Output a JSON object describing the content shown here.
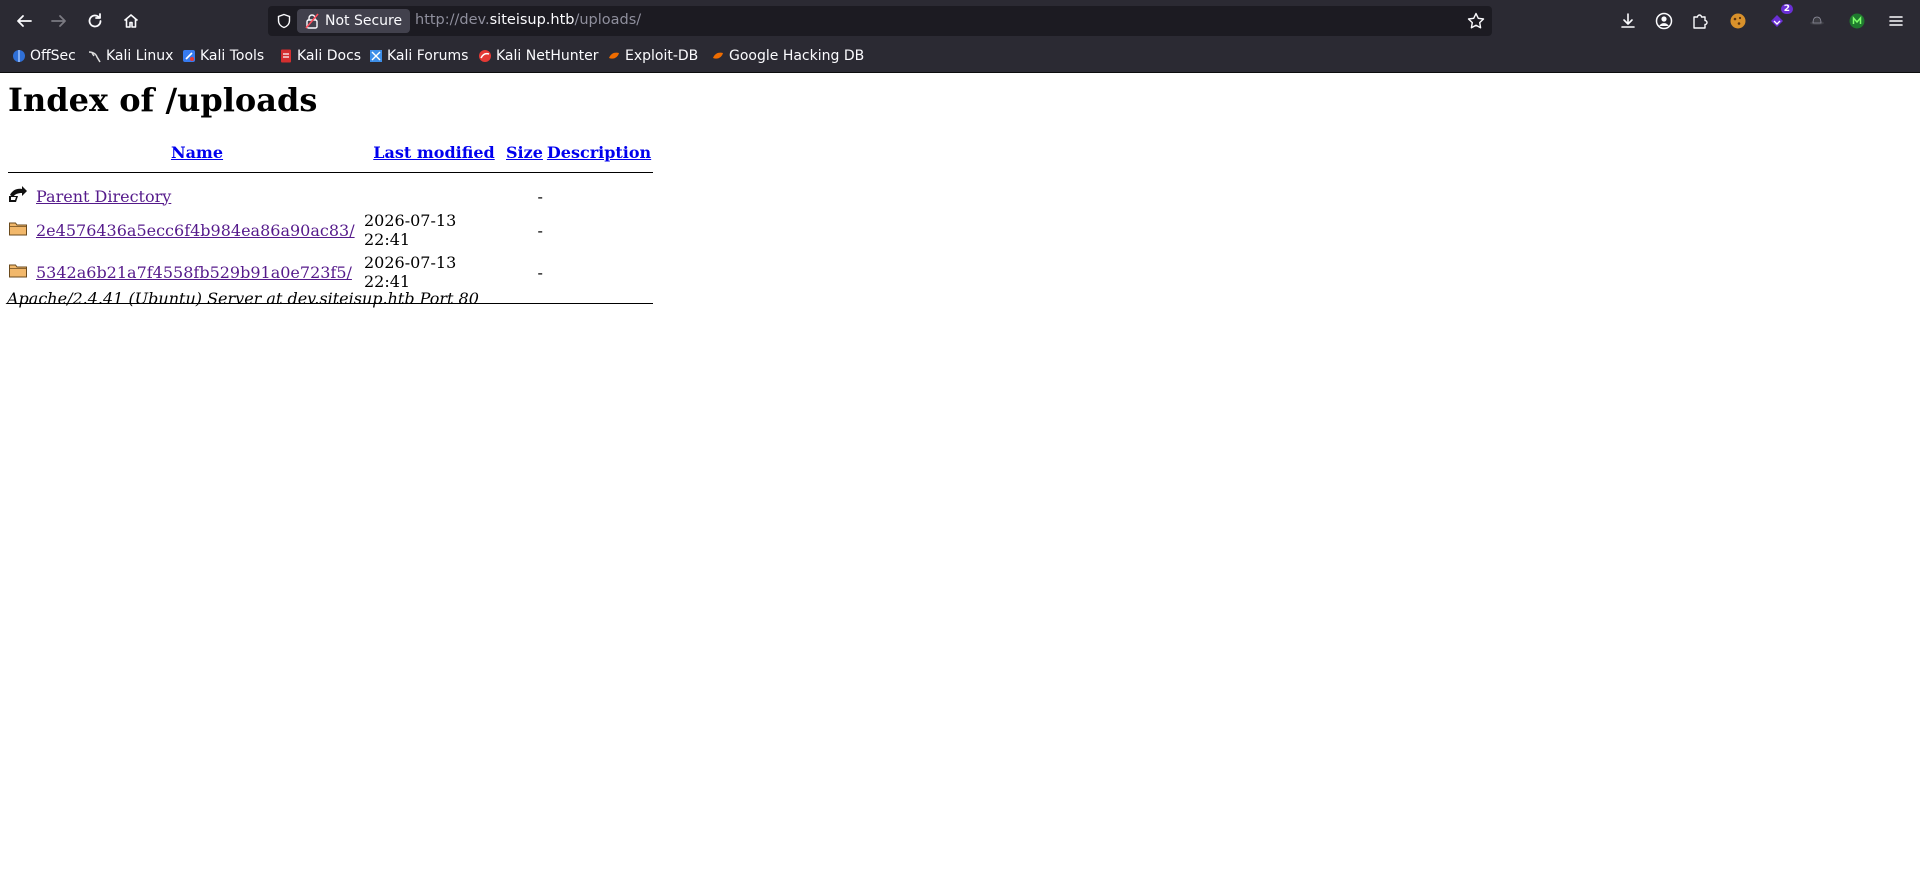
{
  "browser": {
    "security_label": "Not Secure",
    "url_prefix": "http://dev.",
    "url_host": "siteisup.htb",
    "url_path": "/uploads/",
    "extension_badge_count": "2"
  },
  "bookmarks": [
    {
      "label": "OffSec",
      "icon": "offsec-icon",
      "color": "#2f6fd6"
    },
    {
      "label": "Kali Linux",
      "icon": "kali-dragon-icon",
      "color": "#dddddd"
    },
    {
      "label": "Kali Tools",
      "icon": "kali-tools-icon",
      "color": "#367bf0"
    },
    {
      "label": "Kali Docs",
      "icon": "kali-docs-icon",
      "color": "#d32f2f"
    },
    {
      "label": "Kali Forums",
      "icon": "kali-forums-icon",
      "color": "#3d8ee8"
    },
    {
      "label": "Kali NetHunter",
      "icon": "nethunter-icon",
      "color": "#e53935"
    },
    {
      "label": "Exploit-DB",
      "icon": "exploitdb-icon",
      "color": "#ef6c00"
    },
    {
      "label": "Google Hacking DB",
      "icon": "ghdb-icon",
      "color": "#ef6c00"
    }
  ],
  "page": {
    "title": "Index of /uploads",
    "columns": {
      "name": "Name",
      "last_modified": "Last modified",
      "size": "Size",
      "description": "Description"
    },
    "rows": [
      {
        "icon": "parent-directory-icon",
        "name": "Parent Directory",
        "modified": "",
        "size": "-",
        "description": ""
      },
      {
        "icon": "folder-icon",
        "name": "2e4576436a5ecc6f4b984ea86a90ac83/",
        "modified": "2026-07-13 22:41",
        "size": "-",
        "description": ""
      },
      {
        "icon": "folder-icon",
        "name": "5342a6b21a7f4558fb529b91a0e723f5/",
        "modified": "2026-07-13 22:41",
        "size": "-",
        "description": ""
      }
    ],
    "footer": "Apache/2.4.41 (Ubuntu) Server at dev.siteisup.htb Port 80"
  }
}
